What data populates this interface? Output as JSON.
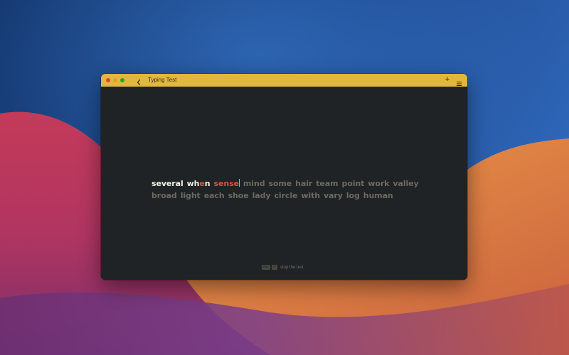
{
  "window": {
    "title": "Typing Test",
    "add_label": "+"
  },
  "typing": {
    "lines": [
      [
        {
          "chars": [
            [
              "s",
              "correct"
            ],
            [
              "e",
              "correct"
            ],
            [
              "v",
              "correct"
            ],
            [
              "e",
              "correct"
            ],
            [
              "r",
              "correct"
            ],
            [
              "a",
              "correct"
            ],
            [
              "l",
              "correct"
            ]
          ]
        },
        {
          "chars": [
            [
              "w",
              "correct"
            ],
            [
              "h",
              "correct"
            ],
            [
              "e",
              "incorrect"
            ],
            [
              "n",
              "correct"
            ]
          ]
        },
        {
          "chars": [
            [
              "s",
              "incorrect"
            ],
            [
              "e",
              "incorrect"
            ],
            [
              "n",
              "incorrect"
            ],
            [
              "s",
              "incorrect"
            ],
            [
              "e",
              "incorrect"
            ]
          ],
          "caret": true
        },
        {
          "chars": [
            [
              "m",
              "pending"
            ],
            [
              "i",
              "pending"
            ],
            [
              "n",
              "pending"
            ],
            [
              "d",
              "pending"
            ]
          ]
        },
        {
          "chars": [
            [
              "s",
              "pending"
            ],
            [
              "o",
              "pending"
            ],
            [
              "m",
              "pending"
            ],
            [
              "e",
              "pending"
            ]
          ]
        },
        {
          "chars": [
            [
              "h",
              "pending"
            ],
            [
              "a",
              "pending"
            ],
            [
              "i",
              "pending"
            ],
            [
              "r",
              "pending"
            ]
          ]
        },
        {
          "chars": [
            [
              "t",
              "pending"
            ],
            [
              "e",
              "pending"
            ],
            [
              "a",
              "pending"
            ],
            [
              "m",
              "pending"
            ]
          ]
        },
        {
          "chars": [
            [
              "p",
              "pending"
            ],
            [
              "o",
              "pending"
            ],
            [
              "i",
              "pending"
            ],
            [
              "n",
              "pending"
            ],
            [
              "t",
              "pending"
            ]
          ]
        },
        {
          "chars": [
            [
              "w",
              "pending"
            ],
            [
              "o",
              "pending"
            ],
            [
              "r",
              "pending"
            ],
            [
              "k",
              "pending"
            ]
          ]
        },
        {
          "chars": [
            [
              "v",
              "pending"
            ],
            [
              "a",
              "pending"
            ],
            [
              "l",
              "pending"
            ],
            [
              "l",
              "pending"
            ],
            [
              "e",
              "pending"
            ],
            [
              "y",
              "pending"
            ]
          ]
        }
      ],
      [
        {
          "chars": [
            [
              "b",
              "pending"
            ],
            [
              "r",
              "pending"
            ],
            [
              "o",
              "pending"
            ],
            [
              "a",
              "pending"
            ],
            [
              "d",
              "pending"
            ]
          ]
        },
        {
          "chars": [
            [
              "l",
              "pending"
            ],
            [
              "i",
              "pending"
            ],
            [
              "g",
              "pending"
            ],
            [
              "h",
              "pending"
            ],
            [
              "t",
              "pending"
            ]
          ]
        },
        {
          "chars": [
            [
              "e",
              "pending"
            ],
            [
              "a",
              "pending"
            ],
            [
              "c",
              "pending"
            ],
            [
              "h",
              "pending"
            ]
          ]
        },
        {
          "chars": [
            [
              "s",
              "pending"
            ],
            [
              "h",
              "pending"
            ],
            [
              "o",
              "pending"
            ],
            [
              "e",
              "pending"
            ]
          ]
        },
        {
          "chars": [
            [
              "l",
              "pending"
            ],
            [
              "a",
              "pending"
            ],
            [
              "d",
              "pending"
            ],
            [
              "y",
              "pending"
            ]
          ]
        },
        {
          "chars": [
            [
              "c",
              "pending"
            ],
            [
              "i",
              "pending"
            ],
            [
              "r",
              "pending"
            ],
            [
              "c",
              "pending"
            ],
            [
              "l",
              "pending"
            ],
            [
              "e",
              "pending"
            ]
          ]
        },
        {
          "chars": [
            [
              "w",
              "pending"
            ],
            [
              "i",
              "pending"
            ],
            [
              "t",
              "pending"
            ],
            [
              "h",
              "pending"
            ]
          ]
        },
        {
          "chars": [
            [
              "v",
              "pending"
            ],
            [
              "a",
              "pending"
            ],
            [
              "r",
              "pending"
            ],
            [
              "y",
              "pending"
            ]
          ]
        },
        {
          "chars": [
            [
              "l",
              "pending"
            ],
            [
              "o",
              "pending"
            ],
            [
              "g",
              "pending"
            ]
          ]
        },
        {
          "chars": [
            [
              "h",
              "pending"
            ],
            [
              "u",
              "pending"
            ],
            [
              "m",
              "pending"
            ],
            [
              "a",
              "pending"
            ],
            [
              "n",
              "pending"
            ]
          ]
        }
      ]
    ]
  },
  "footer": {
    "key1": "esc",
    "key2": "⏎",
    "hint": "stop the test"
  },
  "icons": {
    "back": "chevron-left-icon",
    "menu": "hamburger-menu-icon"
  },
  "colors": {
    "titlebar": "#e2b73f",
    "window_bg": "#1f2325",
    "correct": "#f3efe4",
    "incorrect": "#d6543f",
    "pending": "#6e6a61",
    "caret": "#e2b73f"
  }
}
